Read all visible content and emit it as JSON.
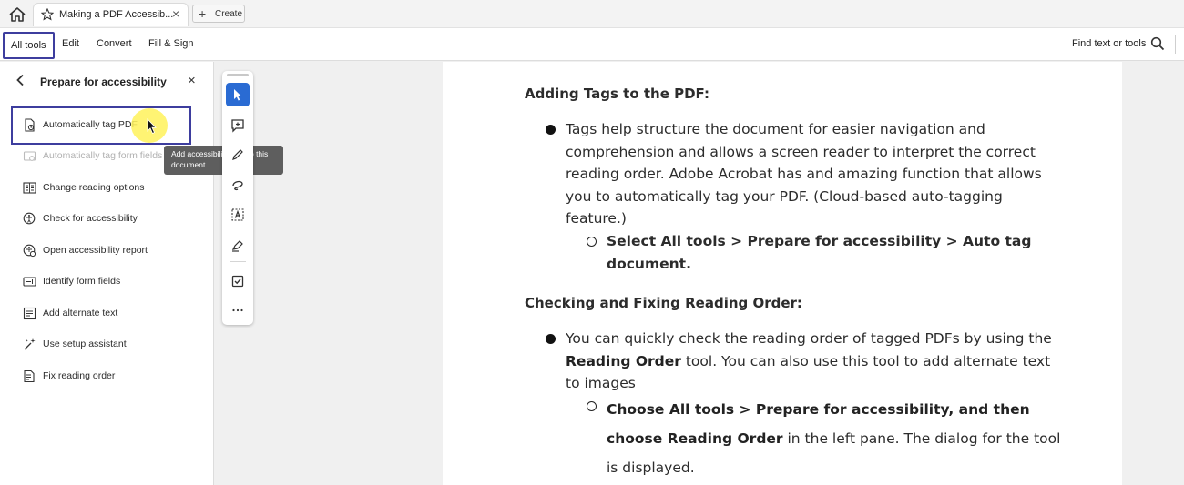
{
  "tabbar": {
    "tab_title": "Making a PDF Accessib...",
    "create_label": "Create"
  },
  "menubar": {
    "items": [
      "All tools",
      "Edit",
      "Convert",
      "Fill & Sign"
    ],
    "find_label": "Find text or tools"
  },
  "panel": {
    "title": "Prepare for accessibility",
    "items": [
      {
        "label": "Automatically tag PDF",
        "icon": "auto-tag-icon",
        "enabled": true
      },
      {
        "label": "Automatically tag form fields",
        "icon": "auto-tag-form-icon",
        "enabled": false
      },
      {
        "label": "Change reading options",
        "icon": "reading-options-icon",
        "enabled": true
      },
      {
        "label": "Check for accessibility",
        "icon": "check-accessibility-icon",
        "enabled": true
      },
      {
        "label": "Open accessibility report",
        "icon": "accessibility-report-icon",
        "enabled": true
      },
      {
        "label": "Identify form fields",
        "icon": "form-fields-icon",
        "enabled": true
      },
      {
        "label": "Add alternate text",
        "icon": "alt-text-icon",
        "enabled": true
      },
      {
        "label": "Use setup assistant",
        "icon": "setup-assistant-icon",
        "enabled": true
      },
      {
        "label": "Fix reading order",
        "icon": "reading-order-icon",
        "enabled": true
      }
    ],
    "tooltip": "Add accessibility tags to this document"
  },
  "toolbar": {
    "tools": [
      "select-icon",
      "add-comment-icon",
      "highlight-icon",
      "draw-icon",
      "text-select-icon",
      "sign-icon",
      "checkbox-icon",
      "more-icon"
    ]
  },
  "document": {
    "heading1": "Adding Tags to the PDF:",
    "para1_lines": [
      "Tags help structure the document for easier navigation and",
      "comprehension and allows a screen reader to interpret the correct",
      "reading order. Adobe Acrobat has and amazing function that allows",
      "you to automatically tag your PDF. (Cloud-based auto-tagging",
      "feature.)"
    ],
    "sub1_lines": [
      "Select All tools > Prepare for accessibility > Auto tag",
      "document."
    ],
    "heading2": "Checking and Fixing Reading Order:",
    "para2_line1": "You can quickly check the reading order of tagged PDFs by using the",
    "para2_line2_bold": "Reading Order",
    "para2_line2_rest": " tool. You can also use this tool to add alternate text",
    "para2_line3": "to images",
    "sub2_line1": "Choose All tools > Prepare for accessibility, and then",
    "sub2_line2_bold": "choose Reading Order",
    "sub2_line2_rest": " in the left pane. The dialog for the tool",
    "sub2_line3": "is displayed."
  }
}
